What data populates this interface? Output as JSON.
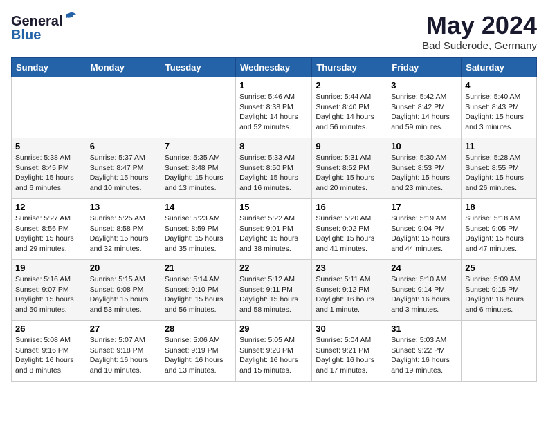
{
  "header": {
    "logo_general": "General",
    "logo_blue": "Blue",
    "month_title": "May 2024",
    "location": "Bad Suderode, Germany"
  },
  "weekdays": [
    "Sunday",
    "Monday",
    "Tuesday",
    "Wednesday",
    "Thursday",
    "Friday",
    "Saturday"
  ],
  "weeks": [
    [
      {
        "day": "",
        "info": ""
      },
      {
        "day": "",
        "info": ""
      },
      {
        "day": "",
        "info": ""
      },
      {
        "day": "1",
        "info": "Sunrise: 5:46 AM\nSunset: 8:38 PM\nDaylight: 14 hours and 52 minutes."
      },
      {
        "day": "2",
        "info": "Sunrise: 5:44 AM\nSunset: 8:40 PM\nDaylight: 14 hours and 56 minutes."
      },
      {
        "day": "3",
        "info": "Sunrise: 5:42 AM\nSunset: 8:42 PM\nDaylight: 14 hours and 59 minutes."
      },
      {
        "day": "4",
        "info": "Sunrise: 5:40 AM\nSunset: 8:43 PM\nDaylight: 15 hours and 3 minutes."
      }
    ],
    [
      {
        "day": "5",
        "info": "Sunrise: 5:38 AM\nSunset: 8:45 PM\nDaylight: 15 hours and 6 minutes."
      },
      {
        "day": "6",
        "info": "Sunrise: 5:37 AM\nSunset: 8:47 PM\nDaylight: 15 hours and 10 minutes."
      },
      {
        "day": "7",
        "info": "Sunrise: 5:35 AM\nSunset: 8:48 PM\nDaylight: 15 hours and 13 minutes."
      },
      {
        "day": "8",
        "info": "Sunrise: 5:33 AM\nSunset: 8:50 PM\nDaylight: 15 hours and 16 minutes."
      },
      {
        "day": "9",
        "info": "Sunrise: 5:31 AM\nSunset: 8:52 PM\nDaylight: 15 hours and 20 minutes."
      },
      {
        "day": "10",
        "info": "Sunrise: 5:30 AM\nSunset: 8:53 PM\nDaylight: 15 hours and 23 minutes."
      },
      {
        "day": "11",
        "info": "Sunrise: 5:28 AM\nSunset: 8:55 PM\nDaylight: 15 hours and 26 minutes."
      }
    ],
    [
      {
        "day": "12",
        "info": "Sunrise: 5:27 AM\nSunset: 8:56 PM\nDaylight: 15 hours and 29 minutes."
      },
      {
        "day": "13",
        "info": "Sunrise: 5:25 AM\nSunset: 8:58 PM\nDaylight: 15 hours and 32 minutes."
      },
      {
        "day": "14",
        "info": "Sunrise: 5:23 AM\nSunset: 8:59 PM\nDaylight: 15 hours and 35 minutes."
      },
      {
        "day": "15",
        "info": "Sunrise: 5:22 AM\nSunset: 9:01 PM\nDaylight: 15 hours and 38 minutes."
      },
      {
        "day": "16",
        "info": "Sunrise: 5:20 AM\nSunset: 9:02 PM\nDaylight: 15 hours and 41 minutes."
      },
      {
        "day": "17",
        "info": "Sunrise: 5:19 AM\nSunset: 9:04 PM\nDaylight: 15 hours and 44 minutes."
      },
      {
        "day": "18",
        "info": "Sunrise: 5:18 AM\nSunset: 9:05 PM\nDaylight: 15 hours and 47 minutes."
      }
    ],
    [
      {
        "day": "19",
        "info": "Sunrise: 5:16 AM\nSunset: 9:07 PM\nDaylight: 15 hours and 50 minutes."
      },
      {
        "day": "20",
        "info": "Sunrise: 5:15 AM\nSunset: 9:08 PM\nDaylight: 15 hours and 53 minutes."
      },
      {
        "day": "21",
        "info": "Sunrise: 5:14 AM\nSunset: 9:10 PM\nDaylight: 15 hours and 56 minutes."
      },
      {
        "day": "22",
        "info": "Sunrise: 5:12 AM\nSunset: 9:11 PM\nDaylight: 15 hours and 58 minutes."
      },
      {
        "day": "23",
        "info": "Sunrise: 5:11 AM\nSunset: 9:12 PM\nDaylight: 16 hours and 1 minute."
      },
      {
        "day": "24",
        "info": "Sunrise: 5:10 AM\nSunset: 9:14 PM\nDaylight: 16 hours and 3 minutes."
      },
      {
        "day": "25",
        "info": "Sunrise: 5:09 AM\nSunset: 9:15 PM\nDaylight: 16 hours and 6 minutes."
      }
    ],
    [
      {
        "day": "26",
        "info": "Sunrise: 5:08 AM\nSunset: 9:16 PM\nDaylight: 16 hours and 8 minutes."
      },
      {
        "day": "27",
        "info": "Sunrise: 5:07 AM\nSunset: 9:18 PM\nDaylight: 16 hours and 10 minutes."
      },
      {
        "day": "28",
        "info": "Sunrise: 5:06 AM\nSunset: 9:19 PM\nDaylight: 16 hours and 13 minutes."
      },
      {
        "day": "29",
        "info": "Sunrise: 5:05 AM\nSunset: 9:20 PM\nDaylight: 16 hours and 15 minutes."
      },
      {
        "day": "30",
        "info": "Sunrise: 5:04 AM\nSunset: 9:21 PM\nDaylight: 16 hours and 17 minutes."
      },
      {
        "day": "31",
        "info": "Sunrise: 5:03 AM\nSunset: 9:22 PM\nDaylight: 16 hours and 19 minutes."
      },
      {
        "day": "",
        "info": ""
      }
    ]
  ]
}
